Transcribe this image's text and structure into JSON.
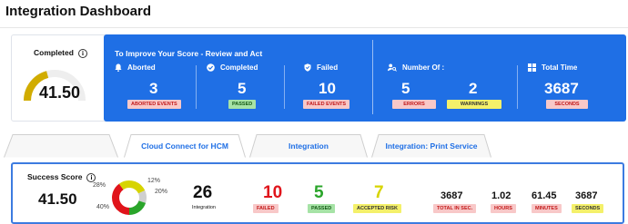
{
  "page": {
    "title": "Integration Dashboard"
  },
  "completed": {
    "label": "Completed",
    "info": "i",
    "value": "41.50",
    "fraction": 0.415
  },
  "panel": {
    "title": "To Improve Your Score - Review and Act",
    "aborted": {
      "label": "Aborted",
      "value": "3",
      "tag": "ABORTED EVENTS"
    },
    "completed": {
      "label": "Completed",
      "value": "5",
      "tag": "PASSED"
    },
    "failed": {
      "label": "Failed",
      "value": "10",
      "tag": "FAILED EVENTS"
    },
    "number_of": {
      "label": "Number Of :",
      "errors_value": "5",
      "errors_tag": "ERRORS",
      "warnings_value": "2",
      "warnings_tag": "WARNINGS"
    },
    "total_time": {
      "label": "Total Time",
      "value": "3687",
      "tag": "SECONDS"
    }
  },
  "tabs": [
    {
      "label": ""
    },
    {
      "label": "Cloud Connect for HCM"
    },
    {
      "label": "Integration"
    },
    {
      "label": "Integration: Print Service"
    }
  ],
  "success": {
    "label": "Success Score",
    "info": "i",
    "value": "41.50",
    "donut": {
      "p28": "28%",
      "p12": "12%",
      "p20": "20%",
      "p40": "40%"
    },
    "integration": {
      "value": "26",
      "label": "Integration"
    },
    "failed": {
      "value": "10",
      "label": "FAILED"
    },
    "passed": {
      "value": "5",
      "label": "PASSED"
    },
    "accepted": {
      "value": "7",
      "label": "ACCEPTED RISK"
    },
    "total": {
      "value": "3687",
      "label": "TOTAL IN SEC."
    },
    "hours": {
      "value": "1.02",
      "label": "HOURS"
    },
    "minutes": {
      "value": "61.45",
      "label": "MINUTES"
    },
    "seconds": {
      "value": "3687",
      "label": "SECONDS"
    }
  },
  "colors": {
    "blue": "#1f6fe5",
    "gauge": "#d1ac00",
    "red": "#e0141b",
    "green": "#2aa52a",
    "yellow": "#d7d400"
  }
}
